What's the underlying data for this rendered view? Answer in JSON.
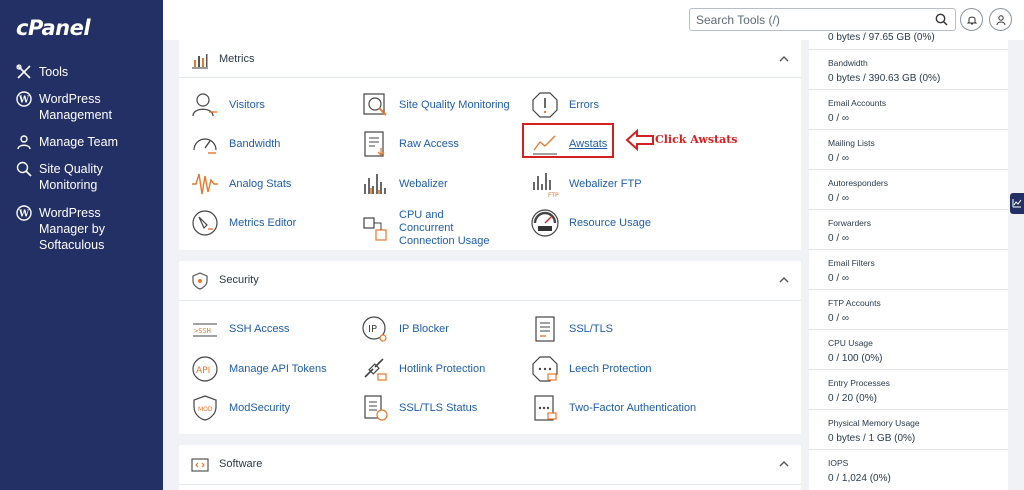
{
  "app": {
    "logo": "cPanel"
  },
  "sidebar": {
    "items": [
      {
        "label": "Tools",
        "icon": "tools-icon"
      },
      {
        "label": "WordPress Management",
        "icon": "wordpress-icon"
      },
      {
        "label": "Manage Team",
        "icon": "team-icon"
      },
      {
        "label": "Site Quality Monitoring",
        "icon": "site-quality-icon"
      },
      {
        "label": "WordPress Manager by Softaculous",
        "icon": "wordpress-icon"
      }
    ]
  },
  "header": {
    "search_placeholder": "Search Tools (/)",
    "notifications_icon": "bell-icon",
    "user_icon": "user-icon"
  },
  "metrics": {
    "title": "Metrics",
    "tools": [
      {
        "label": "Visitors",
        "icon": "visitors-icon"
      },
      {
        "label": "Site Quality Monitoring",
        "icon": "site-quality-monitoring-icon"
      },
      {
        "label": "Errors",
        "icon": "errors-icon"
      },
      {
        "label": "Bandwidth",
        "icon": "bandwidth-icon"
      },
      {
        "label": "Raw Access",
        "icon": "raw-access-icon"
      },
      {
        "label": "Awstats",
        "icon": "awstats-icon"
      },
      {
        "label": "Analog Stats",
        "icon": "analog-stats-icon"
      },
      {
        "label": "Webalizer",
        "icon": "webalizer-icon"
      },
      {
        "label": "Webalizer FTP",
        "icon": "webalizer-ftp-icon"
      },
      {
        "label": "Metrics Editor",
        "icon": "metrics-editor-icon"
      },
      {
        "label": "CPU and Concurrent Connection Usage",
        "icon": "cpu-usage-icon"
      },
      {
        "label": "Resource Usage",
        "icon": "resource-usage-icon"
      }
    ]
  },
  "annotation": {
    "text": "Click Awstats",
    "color": "#d42020"
  },
  "security": {
    "title": "Security",
    "tools": [
      {
        "label": "SSH Access",
        "icon": "ssh-icon"
      },
      {
        "label": "IP Blocker",
        "icon": "ip-blocker-icon"
      },
      {
        "label": "SSL/TLS",
        "icon": "ssl-tls-icon"
      },
      {
        "label": "Manage API Tokens",
        "icon": "api-tokens-icon"
      },
      {
        "label": "Hotlink Protection",
        "icon": "hotlink-icon"
      },
      {
        "label": "Leech Protection",
        "icon": "leech-icon"
      },
      {
        "label": "ModSecurity",
        "icon": "modsecurity-icon"
      },
      {
        "label": "SSL/TLS Status",
        "icon": "ssl-status-icon"
      },
      {
        "label": "Two-Factor Authentication",
        "icon": "two-factor-icon"
      }
    ]
  },
  "software": {
    "title": "Software"
  },
  "stats": {
    "top_partial": "0 bytes / 97.65 GB  (0%)",
    "items": [
      {
        "label": "Bandwidth",
        "value": "0 bytes / 390.63 GB  (0%)"
      },
      {
        "label": "Email Accounts",
        "value": "0 / ∞"
      },
      {
        "label": "Mailing Lists",
        "value": "0 / ∞"
      },
      {
        "label": "Autoresponders",
        "value": "0 / ∞"
      },
      {
        "label": "Forwarders",
        "value": "0 / ∞"
      },
      {
        "label": "Email Filters",
        "value": "0 / ∞"
      },
      {
        "label": "FTP Accounts",
        "value": "0 / ∞"
      },
      {
        "label": "CPU Usage",
        "value": "0 / 100  (0%)"
      },
      {
        "label": "Entry Processes",
        "value": "0 / 20  (0%)"
      },
      {
        "label": "Physical Memory Usage",
        "value": "0 bytes / 1 GB  (0%)"
      },
      {
        "label": "IOPS",
        "value": "0 / 1,024  (0%)"
      }
    ]
  },
  "colors": {
    "sidebar": "#233065",
    "link": "#1f5ea8",
    "accent": "#e8782a",
    "annotation": "#d42020"
  }
}
